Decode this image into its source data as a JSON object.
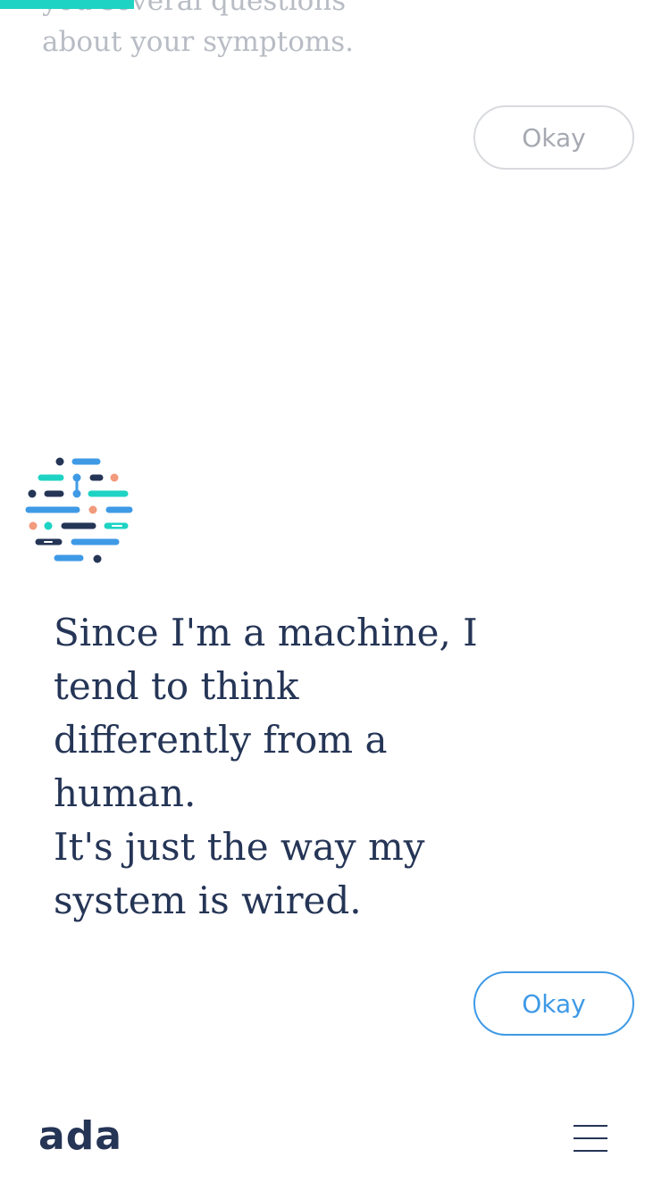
{
  "progress": {
    "fraction": 0.2,
    "color": "#1ed3c3"
  },
  "previous_message": {
    "lines": [
      "you several questions",
      "about your symptoms."
    ]
  },
  "previous_okay_label": "Okay",
  "avatar": {
    "icon": "ada-logo-icon",
    "colors": {
      "navy": "#253556",
      "blue": "#3f9ae6",
      "teal": "#1ed3c3",
      "salmon": "#f29a7c"
    }
  },
  "message": {
    "lines": [
      "Since I'm a machine, I",
      "tend to think",
      "differently from a",
      "human.",
      "It's just the way my",
      "system is wired."
    ]
  },
  "okay_label": "Okay",
  "footer": {
    "brand": "ada",
    "menu_icon": "hamburger-menu-icon"
  },
  "colors": {
    "text_dark": "#253556",
    "text_faded": "#b8bcc4",
    "accent": "#3f9ae6"
  }
}
